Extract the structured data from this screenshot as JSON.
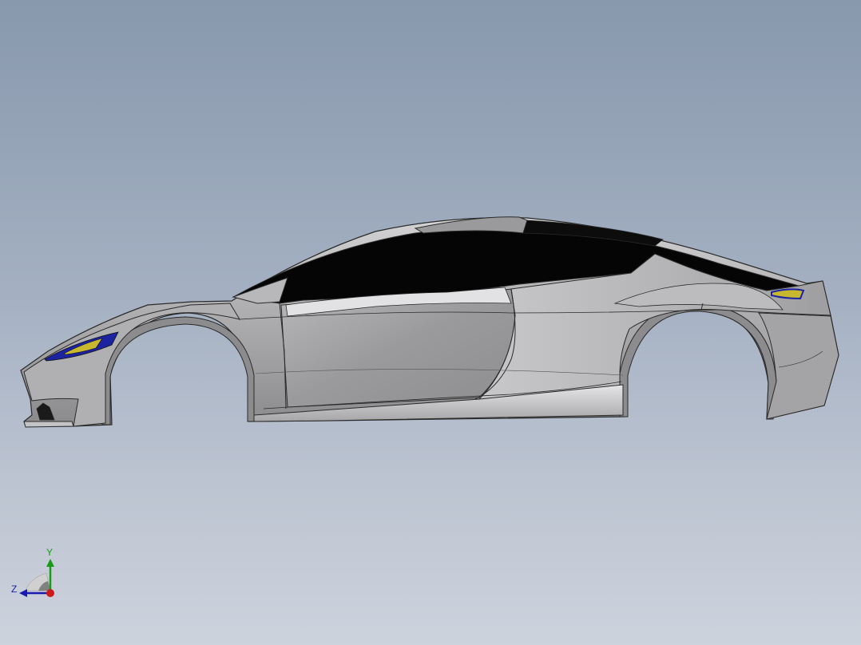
{
  "view": {
    "type": "3d-cad-viewport",
    "background_top": "#8898ad",
    "background_bottom": "#cdd3dd",
    "model": "car-body-shell-side-view"
  },
  "colors": {
    "body": "#a9a9ab",
    "glass": "#050505",
    "edge": "#2a2a2a",
    "lamp_blue": "#1c23a0",
    "lamp_yellow": "#c8b830"
  },
  "triad": {
    "y_label": "Y",
    "z_label": "Z",
    "y_color": "#1a9a1a",
    "z_color": "#1a1ab0",
    "x_color": "#cc1a1a"
  }
}
